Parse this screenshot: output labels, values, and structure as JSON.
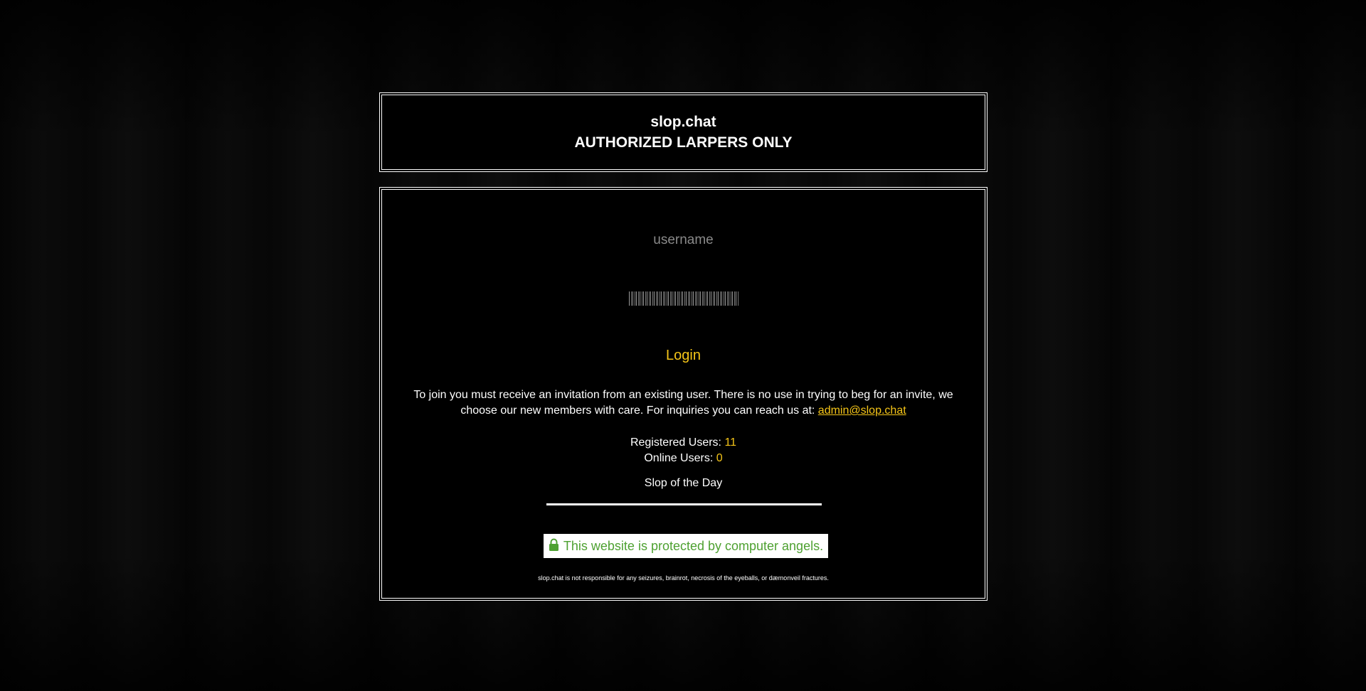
{
  "header": {
    "title": "slop.chat",
    "subtitle": "AUTHORIZED LARPERS ONLY"
  },
  "login_form": {
    "username_placeholder": "username",
    "login_label": "Login"
  },
  "invite": {
    "text": "To join you must receive an invitation from an existing user. There is no use in trying to beg for an invite, we choose our new members with care. For inquiries you can reach us at: ",
    "email": "admin@slop.chat"
  },
  "stats": {
    "registered_label": "Registered Users:",
    "registered_value": "11",
    "online_label": "Online Users:",
    "online_value": "0"
  },
  "slop_of_the_day": {
    "title": "Slop of the Day"
  },
  "protection": {
    "icon": "lock-icon",
    "text": "This website is protected by computer angels."
  },
  "disclaimer": "slop.chat is not responsible for any seizures, brainrot, necrosis of the eyeballs, or dæmonveil fractures.",
  "colors": {
    "accent": "#f5c518",
    "protection_green": "#4ea131",
    "background": "#000000",
    "text": "#ffffff"
  }
}
